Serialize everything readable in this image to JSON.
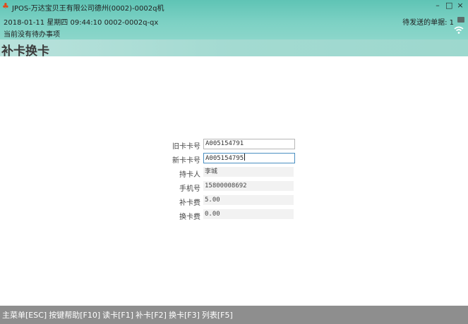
{
  "window": {
    "title": "JPOS-万达宝贝王有限公司德州(0002)-0002q机",
    "controls": [
      "–",
      "□",
      "×"
    ]
  },
  "status": {
    "datetime_line": "2018-01-11 星期四 09:44:10 0002-0002q-qx",
    "pending_label": "待发送的单据: 1",
    "todo": "当前没有待办事项"
  },
  "page": {
    "title": "补卡换卡"
  },
  "form": {
    "old_card_label": "旧卡卡号",
    "old_card_value": "A005154791",
    "new_card_label": "新卡卡号",
    "new_card_value": "A005154795",
    "holder_label": "持卡人",
    "holder_value": "李城",
    "phone_label": "手机号",
    "phone_value": "15800008692",
    "reissue_fee_label": "补卡费",
    "reissue_fee_value": "5.00",
    "exchange_fee_label": "换卡费",
    "exchange_fee_value": "0.00"
  },
  "footer": {
    "main_menu": "主菜单[ESC]",
    "help": "按键帮助[F10]",
    "read_card": "读卡[F1]",
    "reissue": "补卡[F2]",
    "exchange": "换卡[F3]",
    "list": "列表[F5]"
  },
  "colors": {
    "header_accent": "#7dd1c4",
    "footer_bg": "#8e8e8e",
    "active_border": "#4a8fc1"
  }
}
